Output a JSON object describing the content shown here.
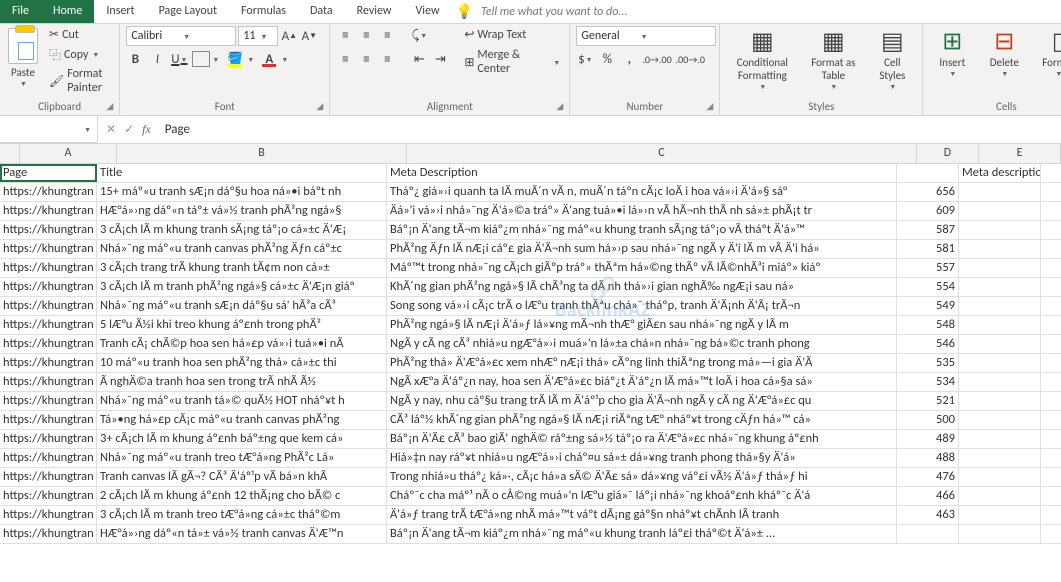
{
  "tabs": {
    "file": "File",
    "home": "Home",
    "insert": "Insert",
    "page_layout": "Page Layout",
    "formulas": "Formulas",
    "data": "Data",
    "review": "Review",
    "view": "View",
    "tell_me": "Tell me what you want to do..."
  },
  "ribbon": {
    "clipboard": {
      "label": "Clipboard",
      "paste": "Paste",
      "cut": "Cut",
      "copy": "Copy",
      "format_painter": "Format Painter"
    },
    "font": {
      "label": "Font",
      "name": "Calibri",
      "size": "11"
    },
    "alignment": {
      "label": "Alignment",
      "wrap": "Wrap Text",
      "merge": "Merge & Center"
    },
    "number": {
      "label": "Number",
      "format": "General"
    },
    "styles": {
      "label": "Styles",
      "cond": "Conditional Formatting",
      "table": "Format as Table",
      "cell": "Cell Styles"
    },
    "cells": {
      "label": "Cells",
      "insert": "Insert",
      "delete": "Delete",
      "format": "Format"
    }
  },
  "formula_bar": {
    "name": "",
    "value": "Page"
  },
  "col_headers": {
    "A": "A",
    "B": "B",
    "C": "C",
    "D": "D",
    "E": "E"
  },
  "sheet_headers": {
    "A": "Page",
    "B": "Title",
    "C": "Meta Description",
    "D": "",
    "E": "Meta description length"
  },
  "rows": [
    {
      "A": "https://khungtran",
      "B": "15+ máº«u tranh sÆ¡n dáº§u hoa ná»•i báº­t nh",
      "C": "Tháº¿ giá»›i quanh ta lÃ  muÃ´n vÃ n, muÃ´n táº­n cÃ¡c loÃ i hoa vá»›i Ä'á»§ sá°",
      "D": "656",
      "E": ""
    },
    {
      "A": "https://khungtran",
      "B": "HÆ°á»›ng dáº«n táº± vá»½ tranh phÃ²ng ngá»§",
      "C": "Äá»'i vá»›i nhá»¯ng Ä'á»©a tráº» Ä'ang tuá»•i lá»›n vÃ  hÃ¬nh thÃ nh sá»± phÃ¡t tr",
      "D": "609",
      "E": ""
    },
    {
      "A": "https://khungtran",
      "B": "3 cÃ¡ch lÃ m khung tranh sÃ¡ng táº¡o cá»±c Ä'Æ¡",
      "C": "Báº¡n Ä'ang tÃ¬m kiáº¿m nhá»¯ng máº«u khung tranh sÃ¡ng táº¡o vÃ  tháº­t Ä'á»™",
      "D": "587",
      "E": ""
    },
    {
      "A": "https://khungtran",
      "B": "Nhá»¯ng máº«u tranh canvas phÃ²ng Äƒn cáº±c",
      "C": "PhÃ²ng Äƒn lÃ  nÆ¡i cáº£ gia Ä'Ã¬nh sum há»›p sau nhá»¯ng ngÃ y Ä'i lÃ m vÃ  Ä'i há»",
      "D": "581",
      "E": ""
    },
    {
      "A": "https://khungtran",
      "B": "3 cÃ¡ch trang trÃ­ khung tranh tÃ¢m non cá»±",
      "C": "Máº™t trong nhá»¯ng cÃ¡ch giÃºp tráº» thÃªm há»©ng thÃº vÃ  lÃ©nhÃ³i miáº» kiáº",
      "D": "557",
      "E": ""
    },
    {
      "A": "https://khungtran",
      "B": "3 cÃ¡ch lÃ m tranh phÃ²ng ngá»§ cá»±c Ä'Æ¡n giáº",
      "C": "KhÃ´ng gian phÃ²ng ngá»§ lÃ  chÃ³ng ta dÃ nh thá»›i gian nghÃ‰ ngÆ¡i sau ná»",
      "D": "554",
      "E": ""
    },
    {
      "A": "https://khungtran",
      "B": "Nhá»¯ng máº«u tranh sÆ¡n dáº§u sá' hÃ³a cÃ³",
      "C": "Song song vá»›i cÃ¡c trÃ o lÆ°u tranh thÃªu chá»¯ tháº­p, tranh Ä'Ã¡nh Ä'Ã¡ trÃ¬n",
      "D": "549",
      "E": ""
    },
    {
      "A": "https://khungtran",
      "B": "5 lÆ°u Ã½i khi treo khung áº£nh trong phÃ²",
      "C": "PhÃ²ng ngá»§ lÃ  nÆ¡i Ä'á»ƒ lá»¥ng mÃ¬nh thÆ° giÃ£n sau nhá»¯ng ngÃ y lÃ  m",
      "D": "548",
      "E": ""
    },
    {
      "A": "https://khungtran",
      "B": "Tranh cÃ¡ chÃ©p hoa sen há»£p vá»›i tuá»•i nÃ",
      "C": "NgÃ y cÃ ng cÃ³ nhiá»u ngÆ°á»›i muá»'n lá»±a chá»n nhá»¯ng bá»©c tranh phong",
      "D": "546",
      "E": ""
    },
    {
      "A": "https://khungtran",
      "B": "10 máº«u tranh hoa sen phÃ²ng thá» cá»±c thi",
      "C": "PhÃ²ng thá» Ä'Æ°á»£c xem nhÆ° nÆ¡i thá» cÃºng linh thiÃªng trong má»—i gia Ä'Ã",
      "D": "535",
      "E": ""
    },
    {
      "A": "https://khungtran",
      "B": "Ã nghÄ©a tranh hoa sen trong trÃ­ nhÃ Ã½",
      "C": "NgÃ xÆ°a Ä'áº¿n nay, hoa sen Ä'Æ°á»£c biáº¿t Ä'áº¿n lÃ  má»™t loÃ  i hoa cá»§a sá»",
      "D": "534",
      "E": ""
    },
    {
      "A": "https://khungtran",
      "B": "Nhá»¯ng máº«u tranh tá»© quÃ½ HOT nháº¥t h",
      "C": "NgÃ y nay, nhu cáº§u trang trÃ­ lÃ m Ä'áº¹p cho gia Ä'Ã¬nh ngÃ y cÃ ng Ä'Æ°á»£c qu",
      "D": "521",
      "E": ""
    },
    {
      "A": "https://khungtran",
      "B": "Tá»•ng há»£p cÃ¡c máº«u tranh canvas phÃ²ng",
      "C": "CÃ³ láº½ khÃ´ng gian phÃ²ng ngá»§ lÃ  nÆ¡i riÃªng tÆ° nháº¥t trong cÄƒn há»™ cá»",
      "D": "500",
      "E": ""
    },
    {
      "A": "https://khungtran",
      "B": "3+ cÃ¡ch lÃ m khung áº£nh báº±ng que kem cá»",
      "C": "Báº¡n Ä'Ã£ cÃ³ bao giÃ' nghÄ© ráº±ng sá»½ táº¡o ra Ä'Æ°á»£c nhá»¯ng khung áº£nh",
      "D": "489",
      "E": ""
    },
    {
      "A": "https://khungtran",
      "B": "Nhá»¯ng máº«u tranh treo tÆ°á»ng PhÃ²c Lá»",
      "C": "Hiá»‡n nay ráº¥t nhiá»u ngÆ°á»›i cháº¤u sá»± dá»¥ng tranh phong thá»§y Ä'á»",
      "D": "488",
      "E": ""
    },
    {
      "A": "https://khungtran",
      "B": "Tranh canvas lÃ  gÃ¬? CÃ³ Ä'áº¹p vÃ  bá»n khÃ",
      "C": "Trong nhiá»u tháº¿ ká»·, cÃ¡c há»a sÄ© Ä'Ã£ sá»­ dá»¥ng váº£i vÃ½ Ä'á»ƒ thá»ƒ hi",
      "D": "476",
      "E": ""
    },
    {
      "A": "https://khungtran",
      "B": "2 cÃ¡ch lÃ m khung áº£nh 12 thÃ¡ng cho bÃ© c",
      "C": "Cháº¯c cha máº¹ nÃ o cÅ©ng muá»'n lÆ°u giá»¯ láº¡i nhá»¯ng khoáº£nh kháº¯c Ä'á",
      "D": "466",
      "E": ""
    },
    {
      "A": "https://khungtran",
      "B": "3 cÃ¡ch lÃ m tranh treo tÆ°á»ng cá»±c tháº©m",
      "C": "Ä'á»ƒ trang trÃ­ tÆ°á»ng nhÃ  má»™t váº­t dÃ¡ng gáº§n nháº¥t chÃ­nh lÃ  tranh",
      "D": "463",
      "E": ""
    },
    {
      "A": "https://khungtran",
      "B": "HÆ°á»›ng dáº«n tá»± vá»½ tranh canvas Ä'Æ™n",
      "C": "Báº¡n Ä'ang tÃ¬m kiáº¿m nhá»¯ng máº«u khung tranh láº£i tháº©t Ä'á»± ...",
      "D": "",
      "E": ""
    }
  ],
  "watermark": "BacklinkAZ"
}
